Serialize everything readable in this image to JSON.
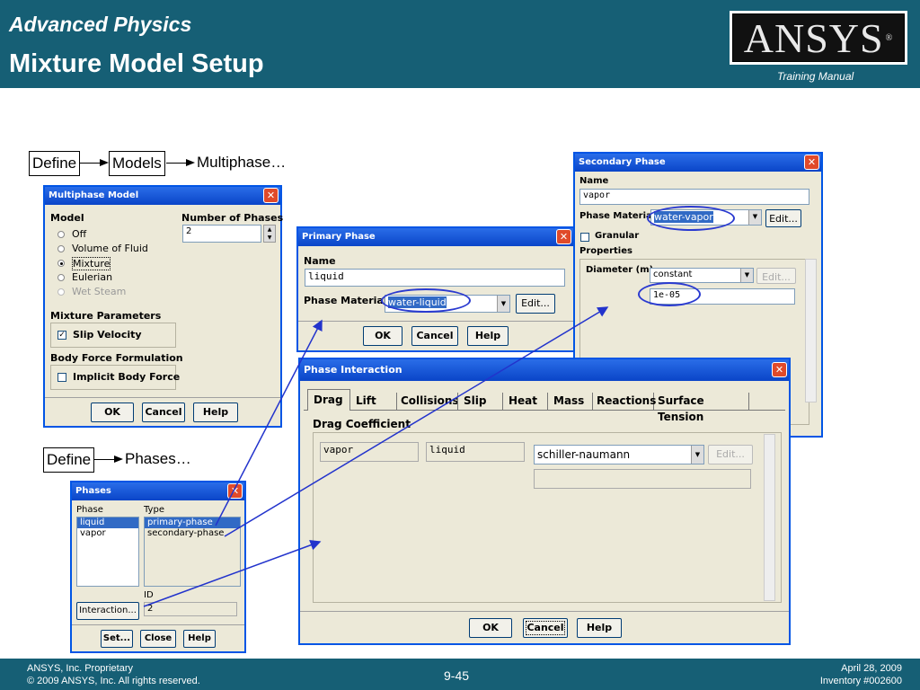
{
  "header": {
    "subtitle": "Advanced Physics",
    "title": "Mixture Model Setup",
    "brand": "ANSYS",
    "brand_mark": "®",
    "training": "Training Manual"
  },
  "footer": {
    "left1": "ANSYS, Inc. Proprietary",
    "left2": "© 2009 ANSYS, Inc.  All rights reserved.",
    "page": "9-45",
    "date": "April 28, 2009",
    "inventory": "Inventory #002600"
  },
  "flow1": {
    "define": "Define",
    "models": "Models",
    "multiphase": "Multiphase…"
  },
  "flow2": {
    "define": "Define",
    "phases": "Phases…"
  },
  "multiphase": {
    "title": "Multiphase Model",
    "model_label": "Model",
    "num_phases_label": "Number of Phases",
    "num_phases": "2",
    "options": [
      "Off",
      "Volume of Fluid",
      "Mixture",
      "Eulerian",
      "Wet Steam"
    ],
    "mixture_params_label": "Mixture Parameters",
    "slip_velocity": "Slip Velocity",
    "body_force_label": "Body Force Formulation",
    "implicit_body_force": "Implicit Body Force",
    "ok": "OK",
    "cancel": "Cancel",
    "help": "Help"
  },
  "primary": {
    "title": "Primary Phase",
    "name_label": "Name",
    "name_value": "liquid",
    "material_label": "Phase Material",
    "material_value": "water-liquid",
    "edit": "Edit...",
    "ok": "OK",
    "cancel": "Cancel",
    "help": "Help"
  },
  "secondary": {
    "title": "Secondary Phase",
    "name_label": "Name",
    "name_value": "vapor",
    "material_label": "Phase Material",
    "material_value": "water-vapor",
    "edit": "Edit...",
    "granular": "Granular",
    "properties_label": "Properties",
    "diameter_label": "Diameter (m)",
    "diameter_method": "constant",
    "diameter_edit": "Edit...",
    "diameter_value": "1e-05"
  },
  "interaction": {
    "title": "Phase Interaction",
    "tabs": [
      "Drag",
      "Lift",
      "Collisions",
      "Slip",
      "Heat",
      "Mass",
      "Reactions",
      "Surface Tension"
    ],
    "drag_coeff_label": "Drag Coefficient",
    "phase1": "vapor",
    "phase2": "liquid",
    "method": "schiller-naumann",
    "edit": "Edit...",
    "ok": "OK",
    "cancel": "Cancel",
    "help": "Help"
  },
  "phases": {
    "title": "Phases",
    "phase_label": "Phase",
    "type_label": "Type",
    "phase_list": [
      "liquid",
      "vapor"
    ],
    "type_list": [
      "primary-phase",
      "secondary-phase"
    ],
    "id_label": "ID",
    "id_value": "2",
    "interaction": "Interaction...",
    "set": "Set...",
    "close": "Close",
    "help": "Help"
  }
}
